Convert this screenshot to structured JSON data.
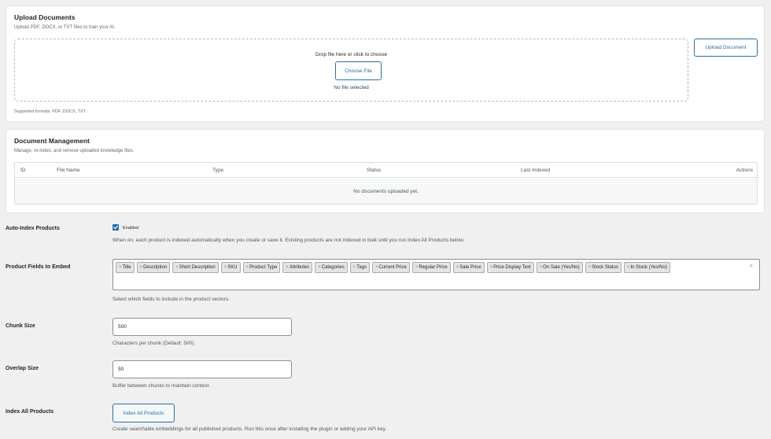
{
  "upload": {
    "title": "Upload Documents",
    "subtitle": "Upload PDF, DOCX, or TXT files to train your AI.",
    "drop_text": "Drop file here or click to choose",
    "choose_label": "Choose File",
    "file_status": "No file selected",
    "upload_label": "Upload Document",
    "supported": "Supported formats: PDF, DOCX, TXT."
  },
  "docs": {
    "title": "Document Management",
    "subtitle": "Manage, re-index, and remove uploaded knowledge files.",
    "columns": [
      "ID",
      "File Name",
      "Type",
      "Status",
      "Last Indexed",
      "Actions"
    ],
    "empty": "No documents uploaded yet."
  },
  "auto_index": {
    "label": "Auto-Index Products",
    "checked": true,
    "checkbox_label": "Enabled",
    "description": "When on, each product is indexed automatically when you create or save it. Existing products are not indexed in bulk until you run Index All Products below."
  },
  "fields": {
    "label": "Product Fields to Embed",
    "tags": [
      "Title",
      "Description",
      "Short Description",
      "SKU",
      "Product Type",
      "Attributes",
      "Categories",
      "Tags",
      "Current Price",
      "Regular Price",
      "Sale Price",
      "Price Display Text",
      "On Sale (Yes/No)",
      "Stock Status",
      "In Stock (Yes/No)"
    ],
    "description": "Select which fields to include in the product vectors."
  },
  "chunk": {
    "label": "Chunk Size",
    "value": "500",
    "description": "Characters per chunk (Default: 500)."
  },
  "overlap": {
    "label": "Overlap Size",
    "value": "50",
    "description": "Buffer between chunks to maintain context."
  },
  "index_all": {
    "label": "Index All Products",
    "button_label": "Index All Products",
    "description": "Create searchable embeddings for all published products. Run this once after installing the plugin or adding your API key."
  },
  "colors": {
    "accent": "#2271b1",
    "card_bg": "#ffffff",
    "page_bg": "#f0f0f1"
  }
}
